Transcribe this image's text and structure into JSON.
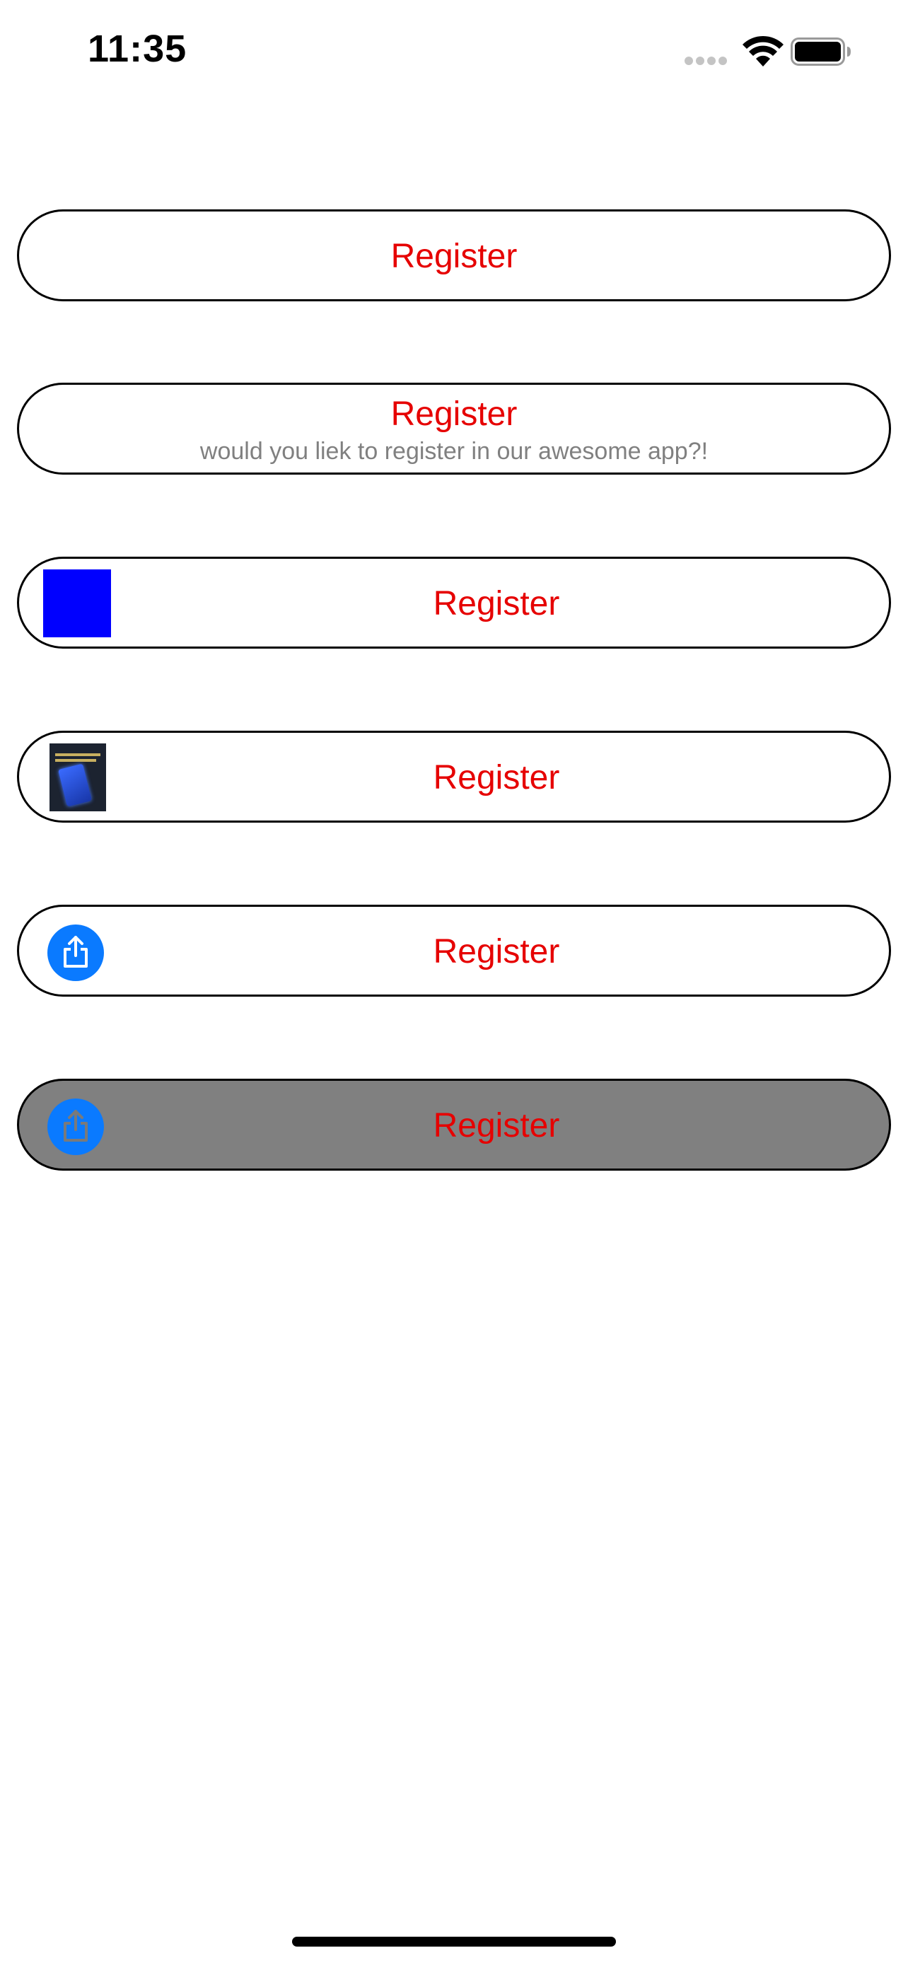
{
  "status_bar": {
    "time": "11:35"
  },
  "buttons": [
    {
      "title": "Register",
      "variant": "plain"
    },
    {
      "title": "Register",
      "subtitle": "would you liek to register in our awesome app?!",
      "variant": "subtitle"
    },
    {
      "title": "Register",
      "variant": "color-square-icon",
      "icon_color": "#0000ff"
    },
    {
      "title": "Register",
      "variant": "image-icon"
    },
    {
      "title": "Register",
      "variant": "share-icon"
    },
    {
      "title": "Register",
      "variant": "disabled-share-icon",
      "background": "#808080"
    }
  ],
  "colors": {
    "title": "#e60000",
    "subtitle": "#808080",
    "border": "#000000",
    "share_circle": "#0a7aff"
  },
  "icons": {
    "status": [
      "signal-icon",
      "wifi-icon",
      "battery-icon"
    ],
    "buttons": [
      "blue-square-icon",
      "book-cover-icon",
      "share-icon",
      "share-icon"
    ]
  }
}
